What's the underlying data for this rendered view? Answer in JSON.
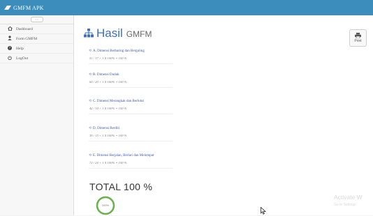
{
  "app": {
    "name": "GMFM APK"
  },
  "sidebar": {
    "collapse_label": "‹ ›",
    "items": [
      {
        "icon": "dashboard-icon",
        "label": "Dashboard"
      },
      {
        "icon": "user-icon",
        "label": "Form GMFM"
      },
      {
        "icon": "help-icon",
        "label": "Help"
      },
      {
        "icon": "power-icon",
        "label": "LogOut"
      }
    ]
  },
  "page": {
    "title": "Hasil",
    "subtitle": "GMFM",
    "print_label": "Print"
  },
  "dimensions": [
    {
      "name": "A. Dimensi Berbaring dan Berguling",
      "formula": "51 / 17 × 1 X 100% = 100 %"
    },
    {
      "name": "B. Dimensi Duduk",
      "formula": "60 / 20 × 1 X 100% = 100 %"
    },
    {
      "name": "C. Dimensi Merangkak dan Berlutut",
      "formula": "42 / 14 × 1 X 100% = 100 %"
    },
    {
      "name": "D. Dimensi Berdiri",
      "formula": "39 / 13 × 1 X 100% = 100 %"
    },
    {
      "name": "E. Dimensi Berjalan, Berlari dan Melompat",
      "formula": "72 / 24 × 1 X 100% = 100 %"
    }
  ],
  "total": {
    "label": "TOTAL 100 %",
    "gauge_text": "100%",
    "gauge_fraction": 1.0
  },
  "colors": {
    "topbar": "#3c8dbc",
    "accent": "#3c6fbf",
    "gauge": "#6ab04c"
  },
  "watermark": {
    "line1": "Activate W",
    "line2": "Go to Settings"
  }
}
